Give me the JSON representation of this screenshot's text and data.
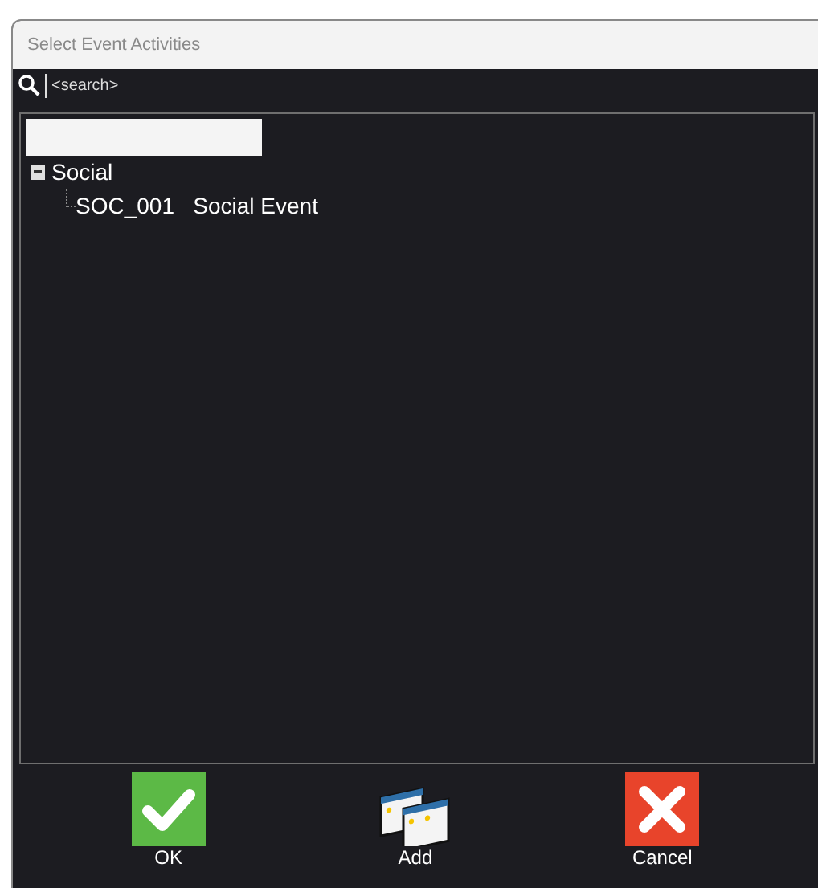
{
  "window": {
    "title": "Select Event Activities"
  },
  "search": {
    "placeholder": "<search>"
  },
  "tree": {
    "nodes": [
      {
        "label": "Social",
        "expanded": true,
        "children": [
          {
            "code": "SOC_001",
            "label": "Social Event"
          }
        ]
      }
    ]
  },
  "buttons": [
    {
      "kind": "ok",
      "label": "OK"
    },
    {
      "kind": "add",
      "label": "Add"
    },
    {
      "kind": "cancel",
      "label": "Cancel"
    }
  ]
}
